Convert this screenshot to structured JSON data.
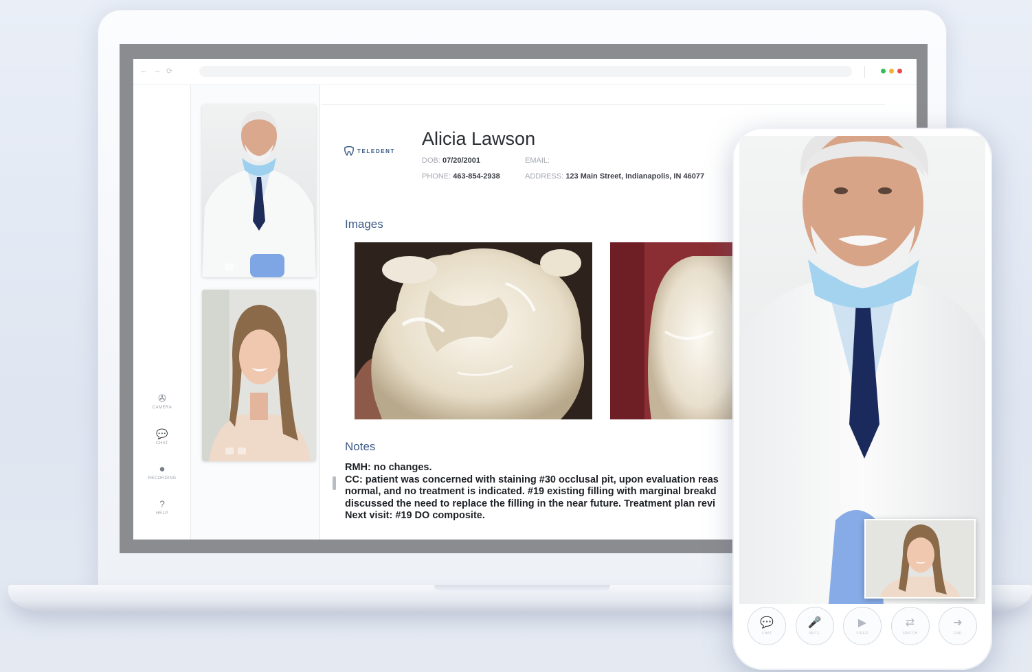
{
  "browser": {
    "nav_back": "←",
    "nav_forward": "→",
    "nav_reload": "⟳",
    "window_dots": [
      "#2fbf5a",
      "#f2b233",
      "#ea4a4a"
    ]
  },
  "sidebar": {
    "items": [
      {
        "icon": "camera-icon",
        "glyph": "✇",
        "label": "CAMERA"
      },
      {
        "icon": "chat-icon",
        "glyph": "💬",
        "label": "CHAT"
      },
      {
        "icon": "recording-icon",
        "glyph": "⏺",
        "label": "RECORDING"
      },
      {
        "icon": "help-icon",
        "glyph": "?",
        "label": "HELP"
      }
    ]
  },
  "brand": {
    "logo_text": "TELEDENT"
  },
  "patient": {
    "name": "Alicia Lawson",
    "dob_label": "DOB:",
    "dob_value": "07/20/2001",
    "phone_label": "PHONE:",
    "phone_value": "463-854-2938",
    "email_label": "EMAIL:",
    "email_value": "",
    "address_label": "ADDRESS:",
    "address_value": "123 Main Street,   Indianapolis, IN 46077"
  },
  "images": {
    "title": "Images"
  },
  "notes": {
    "title": "Notes",
    "lines": [
      "RMH: no changes.",
      "CC: patient was concerned with staining #30 occlusal pit, upon evaluation reas",
      "normal, and no treatment is indicated. #19 existing filling with marginal breakd",
      "discussed the need to replace the filling in the near future. Treatment plan revi",
      "Next visit: #19 DO composite."
    ]
  },
  "phone": {
    "controls": [
      {
        "icon": "chat-icon",
        "glyph": "💬",
        "label": "CHAT"
      },
      {
        "icon": "mic-icon",
        "glyph": "🎤",
        "label": "MUTE"
      },
      {
        "icon": "video-icon",
        "glyph": "▶",
        "label": "VIDEO"
      },
      {
        "icon": "switch-camera-icon",
        "glyph": "⇄",
        "label": "SWITCH"
      },
      {
        "icon": "end-call-icon",
        "glyph": "➜",
        "label": "END"
      }
    ]
  },
  "colors": {
    "accent": "#3f5b86",
    "page_bg": "#e6ebf3"
  }
}
